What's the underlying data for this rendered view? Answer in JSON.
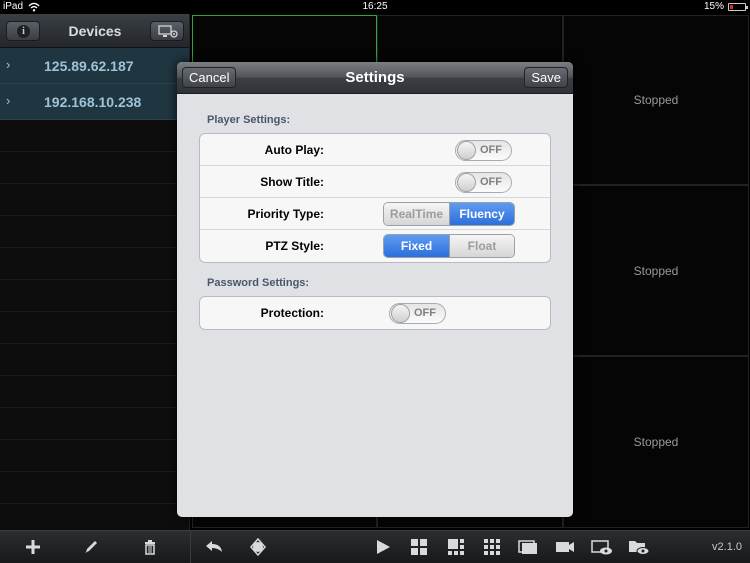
{
  "status_bar": {
    "device": "iPad",
    "time": "16:25",
    "battery": "15%"
  },
  "sidebar": {
    "title": "Devices",
    "devices": [
      {
        "ip": "125.89.62.187"
      },
      {
        "ip": "192.168.10.238"
      }
    ]
  },
  "grid": {
    "cells": [
      {
        "status": ""
      },
      {
        "status": ""
      },
      {
        "status": "Stopped"
      },
      {
        "status": ""
      },
      {
        "status": ""
      },
      {
        "status": "Stopped"
      },
      {
        "status": ""
      },
      {
        "status": ""
      },
      {
        "status": "Stopped"
      }
    ]
  },
  "modal": {
    "title": "Settings",
    "cancel_label": "Cancel",
    "save_label": "Save",
    "player_section": "Player Settings:",
    "auto_play_label": "Auto Play:",
    "auto_play_value": "OFF",
    "show_title_label": "Show Title:",
    "show_title_value": "OFF",
    "priority_label": "Priority Type:",
    "priority_options": [
      "RealTime",
      "Fluency"
    ],
    "priority_selected": "Fluency",
    "ptz_label": "PTZ Style:",
    "ptz_options": [
      "Fixed",
      "Float"
    ],
    "ptz_selected": "Fixed",
    "password_section": "Password Settings:",
    "protection_label": "Protection:",
    "protection_value": "OFF"
  },
  "toolbar": {
    "left_icons": [
      "plus-icon",
      "pencil-icon",
      "trash-icon"
    ],
    "right_icons": [
      "back-arrow-icon",
      "ptz-icon",
      "play-icon",
      "grid-2x2-icon",
      "grid-3-icon",
      "grid-3x3-icon",
      "single-view-icon",
      "record-icon",
      "snapshot-icon",
      "folder-view-icon"
    ],
    "version": "v2.1.0"
  },
  "colors": {
    "accent_blue": "#2c6fdc",
    "active_cell": "#2fa53a",
    "device_text": "#9ec3d6"
  }
}
